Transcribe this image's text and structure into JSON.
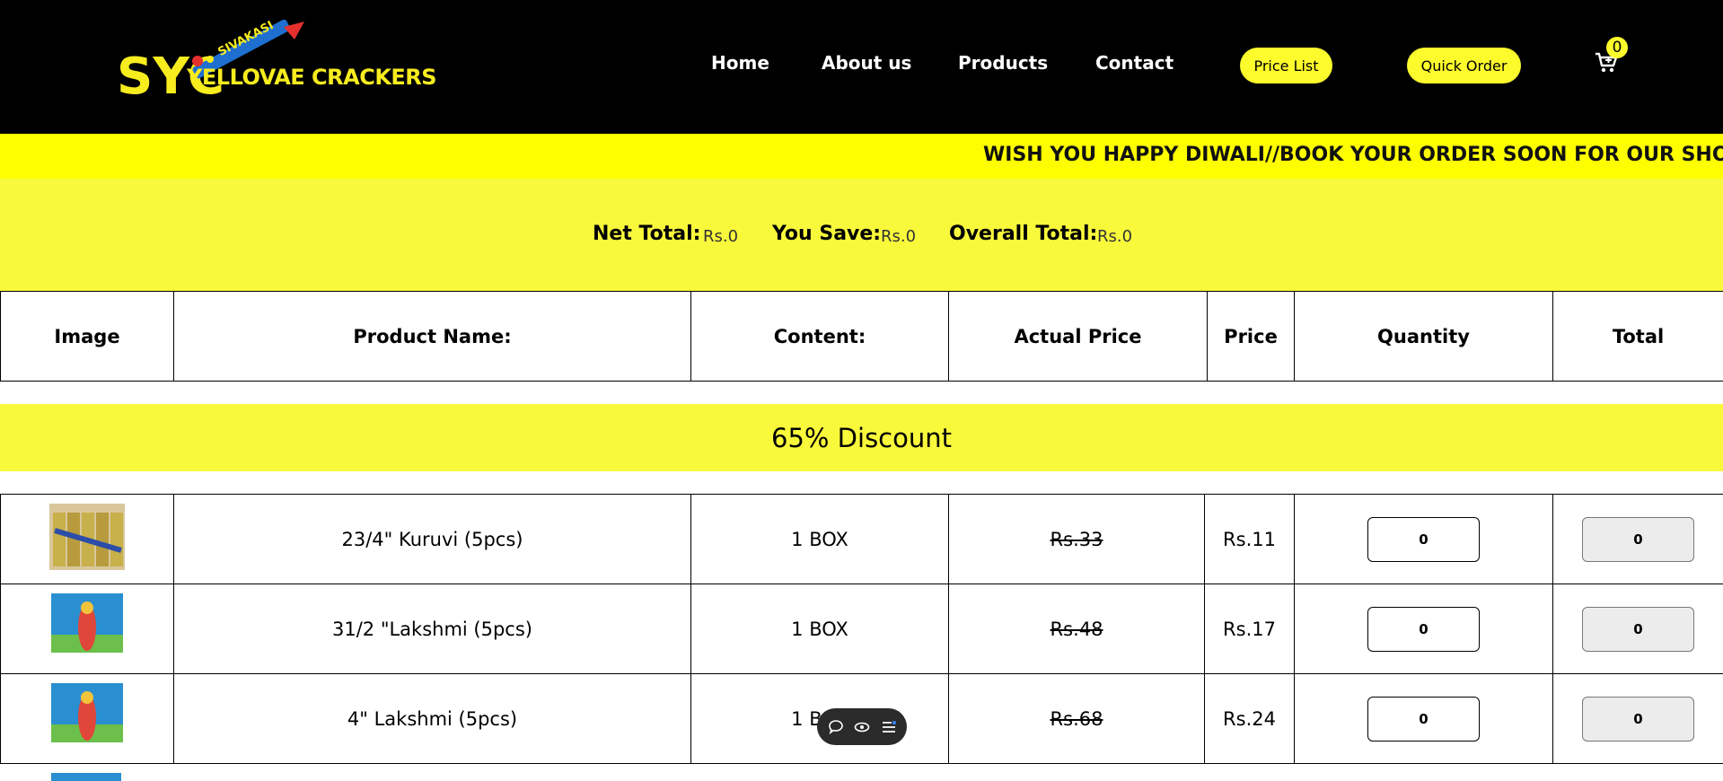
{
  "header": {
    "logo_text": "YELLOVAE CRACKERS",
    "logo_tag": "SIVAKASI",
    "logo_mark": "SYC",
    "nav": [
      "Home",
      "About us",
      "Products",
      "Contact"
    ],
    "price_list_label": "Price List",
    "quick_order_label": "Quick Order",
    "cart_count": "0"
  },
  "marquee": {
    "text": "WISH YOU HAPPY DIWALI//BOOK YOUR ORDER SOON FOR OUR SHOP"
  },
  "totals": {
    "net_label": "Net Total:",
    "net_value": "Rs.0",
    "save_label": "You Save:",
    "save_value": "Rs.0",
    "overall_label": "Overall Total:",
    "overall_value": "Rs.0"
  },
  "table": {
    "headers": [
      "Image",
      "Product Name:",
      "Content:",
      "Actual Price",
      "Price",
      "Quantity",
      "Total"
    ],
    "section": "65% Discount",
    "rows": [
      {
        "name": "23/4\" Kuruvi (5pcs)",
        "content": "1 BOX",
        "actual": "Rs.33",
        "price": "Rs.11",
        "qty": "0",
        "total": "0"
      },
      {
        "name": "31/2 \"Lakshmi (5pcs)",
        "content": "1 BOX",
        "actual": "Rs.48",
        "price": "Rs.17",
        "qty": "0",
        "total": "0"
      },
      {
        "name": "4\" Lakshmi (5pcs)",
        "content": "1 BOX",
        "actual": "Rs.68",
        "price": "Rs.24",
        "qty": "0",
        "total": "0"
      }
    ]
  },
  "colors": {
    "brand_yellow": "#fdfb2c",
    "band_yellow": "#f9f93c",
    "marquee_yellow": "#fefe00",
    "header_bg": "#000000"
  },
  "icons": [
    "cart-icon",
    "comment-icon",
    "eye-icon",
    "list-icon"
  ]
}
